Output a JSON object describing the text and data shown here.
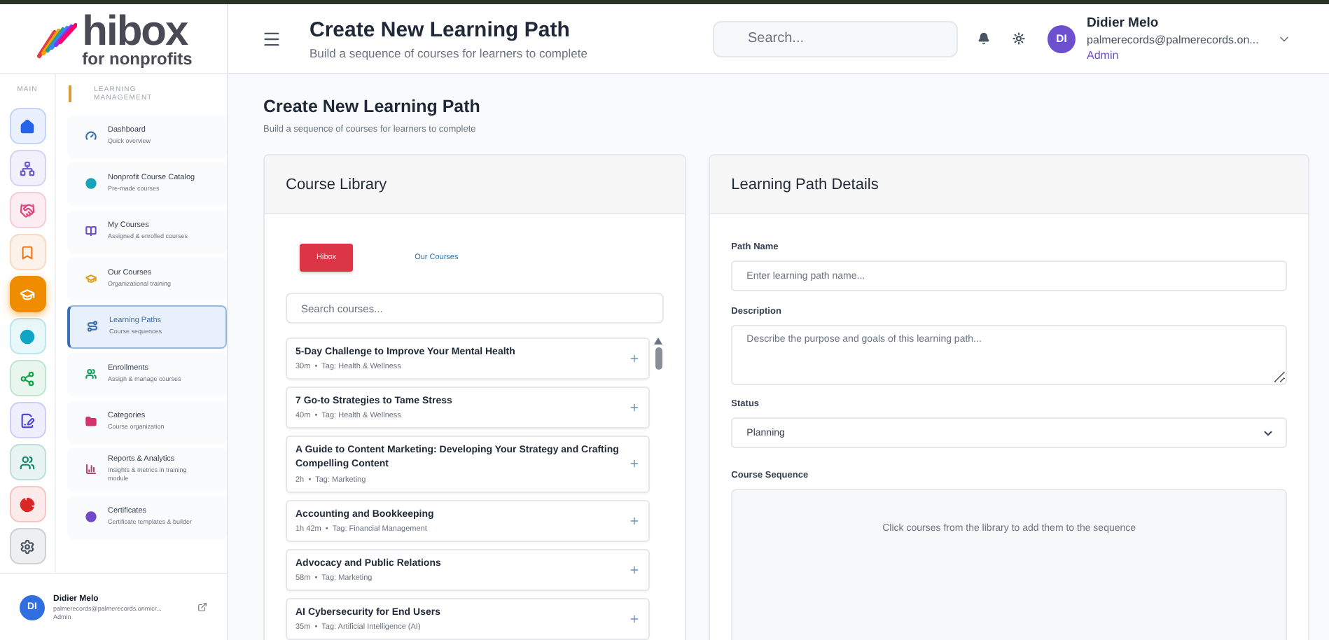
{
  "logo": {
    "name": "hibox",
    "tagline": "for nonprofits"
  },
  "rail": {
    "label": "MAIN",
    "items": [
      {
        "kind": "home",
        "color": "#2563eb",
        "selected": false
      },
      {
        "kind": "sitemap",
        "color": "#6d5bd0",
        "selected": false
      },
      {
        "kind": "handshake",
        "color": "#e0457b",
        "selected": false
      },
      {
        "kind": "bookmark",
        "color": "#ea7a1a",
        "selected": false
      },
      {
        "kind": "graduation",
        "color": "#f08c00",
        "selected": true
      },
      {
        "kind": "dot",
        "color": "#0ea5c6",
        "selected": false
      },
      {
        "kind": "network",
        "color": "#16a34a",
        "selected": false
      },
      {
        "kind": "edit",
        "color": "#4f46e5",
        "selected": false
      },
      {
        "kind": "users",
        "color": "#0f8a6a",
        "selected": false
      },
      {
        "kind": "pie",
        "color": "#dc2626",
        "selected": false
      },
      {
        "kind": "settings",
        "color": "#4b5563",
        "selected": false
      }
    ]
  },
  "menu": {
    "section": "LEARNING MANAGEMENT",
    "items": [
      {
        "kind": "gauge",
        "title": "Dashboard",
        "subtitle": "Quick overview",
        "color": "#2f6fb0",
        "selected": false
      },
      {
        "kind": "dot",
        "title": "Nonprofit Course Catalog",
        "subtitle": "Pre-made courses",
        "color": "#1aa3b8",
        "selected": false
      },
      {
        "kind": "book",
        "title": "My Courses",
        "subtitle": "Assigned & enrolled courses",
        "color": "#6d4fd0",
        "selected": false
      },
      {
        "kind": "graduation",
        "title": "Our Courses",
        "subtitle": "Organizational training",
        "color": "#e0a020",
        "selected": false
      },
      {
        "kind": "route",
        "title": "Learning Paths",
        "subtitle": "Course sequences",
        "color": "#3b6fb6",
        "selected": true
      },
      {
        "kind": "users",
        "title": "Enrollments",
        "subtitle": "Assign & manage courses",
        "color": "#17a05d",
        "selected": false
      },
      {
        "kind": "folder",
        "title": "Categories",
        "subtitle": "Course organization",
        "color": "#d6336c",
        "selected": false
      },
      {
        "kind": "chart",
        "title": "Reports & Analytics",
        "subtitle": "Insights & metrics in training module",
        "color": "#b04a6a",
        "selected": false
      },
      {
        "kind": "dot",
        "title": "Certificates",
        "subtitle": "Certificate templates & builder",
        "color": "#7048c8",
        "selected": false
      }
    ]
  },
  "sidebar_user": {
    "initials": "DI",
    "name": "Didier Melo",
    "email": "palmerecords@palmerecords.onmicr...",
    "role": "Admin"
  },
  "header": {
    "title": "Create New Learning Path",
    "subtitle": "Build a sequence of courses for learners to complete",
    "search_placeholder": "Search...",
    "user": {
      "initials": "DI",
      "name": "Didier Melo",
      "email": "palmerecords@palmerecords.on...",
      "role": "Admin"
    }
  },
  "page": {
    "title": "Create New Learning Path",
    "subtitle": "Build a sequence of courses for learners to complete"
  },
  "library": {
    "title": "Course Library",
    "tabs": [
      {
        "label": "Hibox",
        "selected": true
      },
      {
        "label": "Our Courses",
        "selected": false
      }
    ],
    "search_placeholder": "Search courses...",
    "courses": [
      {
        "title": "5-Day Challenge to Improve Your Mental Health",
        "duration": "30m",
        "separator": "•",
        "tag": "Tag: Health & Wellness"
      },
      {
        "title": "7 Go-to Strategies to Tame Stress",
        "duration": "40m",
        "separator": "•",
        "tag": "Tag: Health & Wellness"
      },
      {
        "title": "A Guide to Content Marketing: Developing Your Strategy and Crafting Compelling Content",
        "duration": "2h",
        "separator": "•",
        "tag": "Tag: Marketing"
      },
      {
        "title": "Accounting and Bookkeeping",
        "duration": "1h 42m",
        "separator": "•",
        "tag": "Tag: Financial Management"
      },
      {
        "title": "Advocacy and Public Relations",
        "duration": "58m",
        "separator": "•",
        "tag": "Tag: Marketing"
      },
      {
        "title": "AI Cybersecurity for End Users",
        "duration": "35m",
        "separator": "•",
        "tag": "Tag: Artificial Intelligence (AI)"
      }
    ]
  },
  "details": {
    "title": "Learning Path Details",
    "path_name": {
      "label": "Path Name",
      "placeholder": "Enter learning path name..."
    },
    "description": {
      "label": "Description",
      "placeholder": "Describe the purpose and goals of this learning path..."
    },
    "status": {
      "label": "Status",
      "value": "Planning"
    },
    "sequence": {
      "label": "Course Sequence",
      "empty_text": "Click courses from the library to add them to the sequence"
    }
  }
}
